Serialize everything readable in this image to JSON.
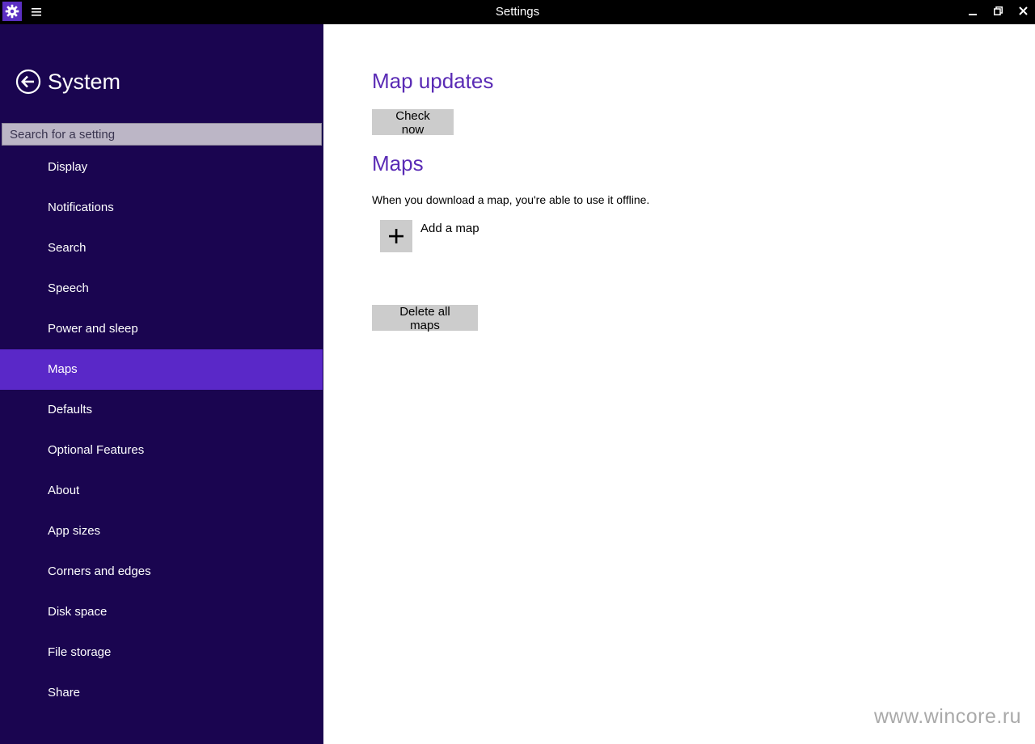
{
  "window": {
    "title": "Settings"
  },
  "sidebar": {
    "title": "System",
    "search_placeholder": "Search for a setting",
    "items": [
      {
        "label": "Display"
      },
      {
        "label": "Notifications"
      },
      {
        "label": "Search"
      },
      {
        "label": "Speech"
      },
      {
        "label": "Power and sleep"
      },
      {
        "label": "Maps",
        "selected": true
      },
      {
        "label": "Defaults"
      },
      {
        "label": "Optional Features"
      },
      {
        "label": "About"
      },
      {
        "label": "App sizes"
      },
      {
        "label": "Corners and edges"
      },
      {
        "label": "Disk space"
      },
      {
        "label": "File storage"
      },
      {
        "label": "Share"
      }
    ]
  },
  "main": {
    "map_updates_heading": "Map updates",
    "check_now_label": "Check now",
    "maps_heading": "Maps",
    "maps_description": "When you download a map, you're able to use it offline.",
    "add_map_label": "Add a map",
    "delete_all_label": "Delete all maps"
  },
  "watermark": "www.wincore.ru",
  "colors": {
    "titlebar_bg": "#000000",
    "sidebar_bg": "#1a0550",
    "selected_item_bg": "#5a28c8",
    "heading_accent": "#5a2bb5",
    "button_bg": "#cccccc",
    "app_icon_bg": "#5b2fc2"
  },
  "icons": {
    "app": "gear-icon",
    "menu": "hamburger-icon",
    "back": "back-arrow-icon",
    "add": "plus-icon",
    "minimize": "minimize-icon",
    "restore": "restore-icon",
    "close": "close-icon"
  }
}
